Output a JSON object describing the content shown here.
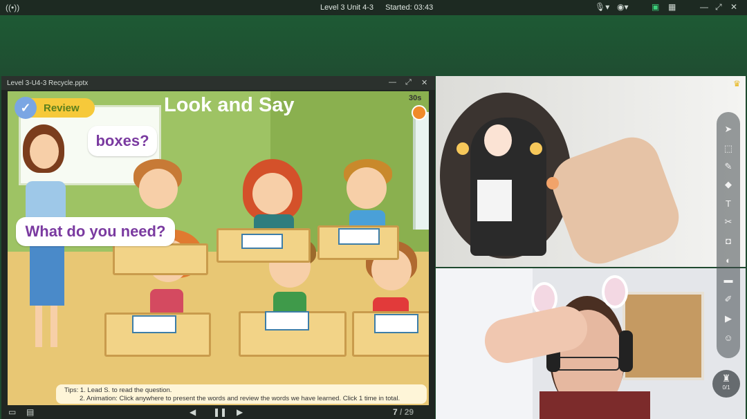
{
  "topbar": {
    "class_name": "Level 3 Unit 4-3",
    "started_label": "Started: 03:43"
  },
  "document": {
    "filename": "Level 3-U4-3 Recycle.pptx",
    "page_current": "7",
    "page_separator": " / ",
    "page_total": "29"
  },
  "slide": {
    "badge": "Review",
    "title": "Look and Say",
    "timer": "30s",
    "bubble_question_word": "boxes?",
    "bubble_question": "What do you need?",
    "tips_line1": "Tips: 1. Lead S. to read the question.",
    "tips_line2": "2. Animation: Click anywhere to present the words and review the words we have learned. Click 1 time in total."
  },
  "whiteboard": {
    "counter": "0/1"
  },
  "colors": {
    "accent_green": "#1f4d31",
    "bubble_text": "#7a3aa0",
    "slide_title": "#ffffff"
  },
  "icons": {
    "signal": "signal-icon",
    "mic": "microphone-icon",
    "camera": "camera-icon",
    "record": "record-icon",
    "layout": "grid-layout-icon",
    "minimize": "minimize-icon",
    "close": "close-icon",
    "prev": "previous-icon",
    "pause": "pause-icon",
    "next": "next-icon"
  }
}
